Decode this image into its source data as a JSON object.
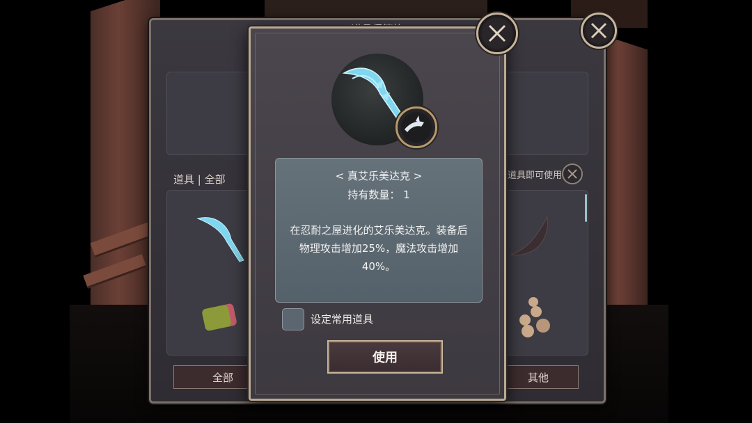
{
  "background_panel": {
    "title": "道具保管箱",
    "tab_label": "道具 | 全部",
    "filter_text": "装备道具即可使用",
    "bottom_tabs": [
      "全部",
      "其他"
    ]
  },
  "item_dialog": {
    "name": "< 真艾乐美达克 >",
    "quantity_text": "持有数量： 1",
    "description": "在忍耐之屋进化的艾乐美达克。装备后物理攻击增加25%，魔法攻击增加40%。",
    "checkbox_label": "设定常用道具",
    "checkbox_checked": false,
    "use_button": "使用"
  },
  "icons": {
    "close": "close-x-icon",
    "item": "crystal-scythe-icon",
    "badge": "shark-badge-icon"
  },
  "colors": {
    "frame_gold": "#b9aa94",
    "panel_bg": "#3d3940",
    "desc_bg": "#5f6b73",
    "item_cyan": "#7fd6ee"
  }
}
